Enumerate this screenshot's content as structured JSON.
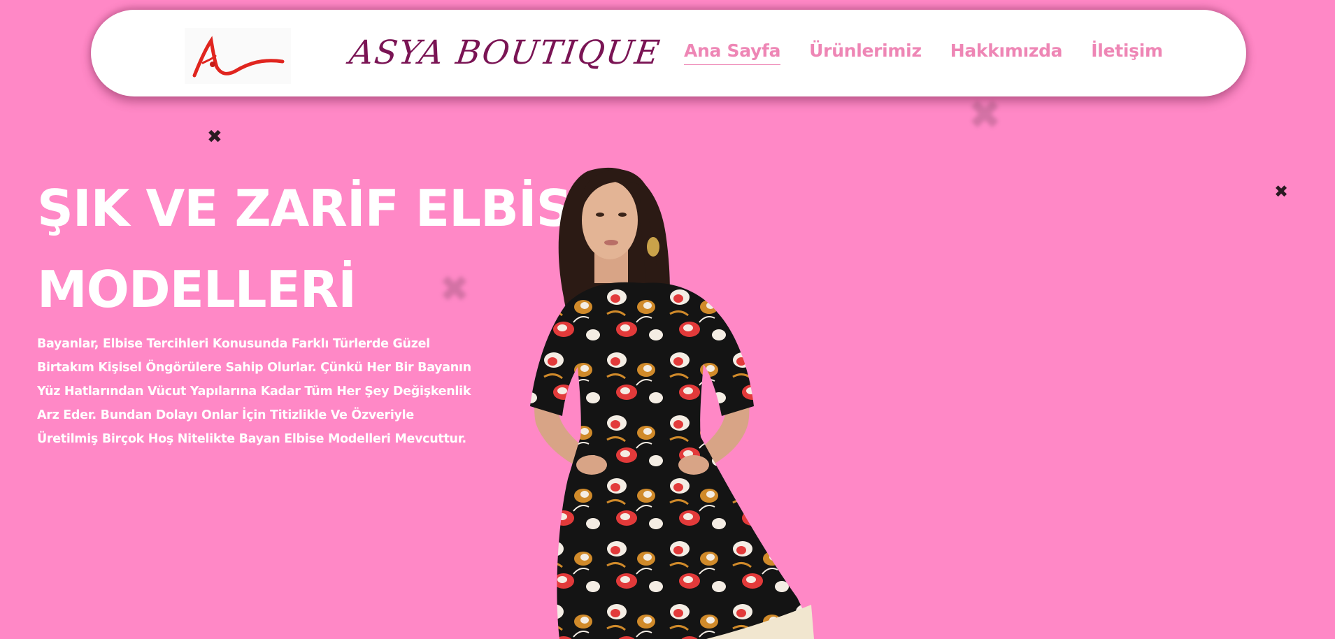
{
  "header": {
    "logo_icon": "asya-boutique-logo",
    "brand_title": "ASYA BOUTIQUE",
    "nav": [
      {
        "label": "Ana Sayfa",
        "active": true
      },
      {
        "label": "Ürünlerimiz",
        "active": false
      },
      {
        "label": "Hakkımızda",
        "active": false
      },
      {
        "label": "İletişim",
        "active": false
      }
    ]
  },
  "hero": {
    "title_line1": "ŞIK VE ZARİF ELBİSE",
    "title_line2": "MODELLERİ",
    "description": "Bayanlar, Elbise Tercihleri Konusunda Farklı Türlerde Güzel Birtakım Kişisel Öngörülere Sahip Olurlar. Çünkü Her Bir Bayanın Yüz Hatlarından Vücut Yapılarına Kadar Tüm Her Şey Değişkenlik Arz Eder. Bundan Dolayı Onlar İçin Titizlikle Ve Özveriyle Üretilmiş Birçok Hoş Nitelikte Bayan Elbise Modelleri Mevcuttur.",
    "model_image": "woman-in-floral-dress-photo"
  },
  "colors": {
    "background": "#ff88c6",
    "nav_link": "#ee86b5",
    "brand": "#7a1454",
    "logo_red": "#e0251f",
    "hero_text": "#ffffff"
  }
}
